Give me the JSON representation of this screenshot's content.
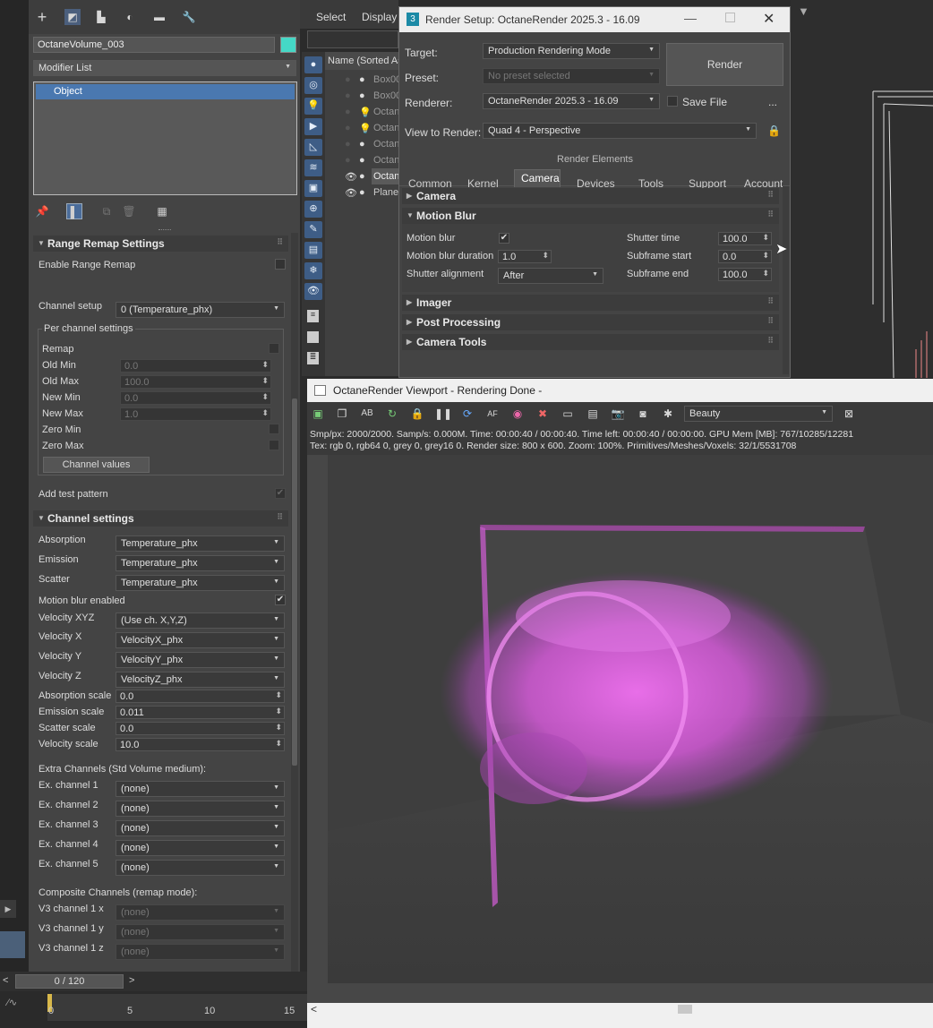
{
  "cmd_panel": {
    "object_name": "OctaneVolume_003",
    "object_color": "#45d8c6",
    "modifier_list": "Modifier List",
    "stack_item": "Object",
    "top_icons": [
      "create-icon",
      "modify-icon",
      "hierarchy-icon",
      "motion-icon",
      "display-icon",
      "utilities-icon"
    ]
  },
  "range_remap": {
    "title": "Range Remap Settings",
    "enable_label": "Enable Range Remap",
    "channel_setup_label": "Channel setup",
    "channel_setup_value": "0 (Temperature_phx)",
    "group_title": "Per channel settings",
    "remap_label": "Remap",
    "old_min_label": "Old Min",
    "old_min_value": "0.0",
    "old_max_label": "Old Max",
    "old_max_value": "100.0",
    "new_min_label": "New Min",
    "new_min_value": "0.0",
    "new_max_label": "New Max",
    "new_max_value": "1.0",
    "zero_min_label": "Zero Min",
    "zero_max_label": "Zero Max",
    "channel_values_btn": "Channel values",
    "test_pattern_label": "Add test pattern"
  },
  "channel_settings": {
    "title": "Channel settings",
    "absorption_label": "Absorption",
    "absorption_value": "Temperature_phx",
    "emission_label": "Emission",
    "emission_value": "Temperature_phx",
    "scatter_label": "Scatter",
    "scatter_value": "Temperature_phx",
    "motion_blur_label": "Motion blur enabled",
    "motion_blur_check": "✔",
    "vel_xyz_label": "Velocity XYZ",
    "vel_xyz_value": "(Use ch. X,Y,Z)",
    "vel_x_label": "Velocity X",
    "vel_x_value": "VelocityX_phx",
    "vel_y_label": "Velocity Y",
    "vel_y_value": "VelocityY_phx",
    "vel_z_label": "Velocity Z",
    "vel_z_value": "VelocityZ_phx",
    "abs_scale_label": "Absorption scale",
    "abs_scale_value": "0.0",
    "em_scale_label": "Emission scale",
    "em_scale_value": "0.011",
    "sc_scale_label": "Scatter scale",
    "sc_scale_value": "0.0",
    "vel_scale_label": "Velocity scale",
    "vel_scale_value": "10.0",
    "extra_title": "Extra Channels (Std Volume medium):",
    "extra": [
      {
        "label": "Ex. channel 1",
        "value": "(none)"
      },
      {
        "label": "Ex. channel 2",
        "value": "(none)"
      },
      {
        "label": "Ex. channel 3",
        "value": "(none)"
      },
      {
        "label": "Ex. channel 4",
        "value": "(none)"
      },
      {
        "label": "Ex. channel 5",
        "value": "(none)"
      }
    ],
    "composite_title": "Composite Channels (remap mode):",
    "v3": [
      {
        "label": "V3 channel 1 x",
        "value": "(none)"
      },
      {
        "label": "V3 channel 1 y",
        "value": "(none)"
      },
      {
        "label": "V3 channel 1 z",
        "value": "(none)"
      }
    ]
  },
  "timeline": {
    "frame": "0 / 120",
    "prev": "<",
    "next": ">",
    "ticks": [
      "0",
      "5",
      "10",
      "15"
    ]
  },
  "scene_explorer": {
    "menu_select": "Select",
    "menu_display": "Display",
    "header": "Name (Sorted As",
    "rows": [
      "Box00",
      "Box00",
      "Octan",
      "Octan",
      "Octan",
      "Octan",
      "Octan",
      "Plane"
    ]
  },
  "render_setup": {
    "title": "Render Setup: OctaneRender 2025.3 - 16.09",
    "target_label": "Target:",
    "target_value": "Production Rendering Mode",
    "preset_label": "Preset:",
    "preset_value": "No preset selected",
    "renderer_label": "Renderer:",
    "renderer_value": "OctaneRender 2025.3 - 16.09",
    "save_file": "Save File",
    "more": "...",
    "render_btn": "Render",
    "view_label": "View to Render:",
    "view_value": "Quad 4 - Perspective",
    "render_elements": "Render Elements",
    "tabs": [
      "Common",
      "Kernel",
      "Camera",
      "Devices",
      "Tools",
      "Support",
      "Account"
    ],
    "camera_rollout": "Camera",
    "motion_blur_rollout": "Motion Blur",
    "mb_label": "Motion blur",
    "mb_check": "✔",
    "mb_duration_label": "Motion blur duration",
    "mb_duration_value": "1.0",
    "shutter_align_label": "Shutter alignment",
    "shutter_align_value": "After",
    "shutter_time_label": "Shutter time",
    "shutter_time_value": "100.0",
    "subframe_start_label": "Subframe start",
    "subframe_start_value": "0.0",
    "subframe_end_label": "Subframe end",
    "subframe_end_value": "100.0",
    "imager_rollout": "Imager",
    "post_rollout": "Post Processing",
    "camtools_rollout": "Camera Tools"
  },
  "viewport": {
    "title": "OctaneRender Viewport - Rendering Done -",
    "pass_value": "Beauty",
    "stats_line1": "Smp/px: 2000/2000.   Samp/s: 0.000M.   Time: 00:00:40 / 00:00:40.   Time left: 00:00:40 / 00:00:00.   GPU Mem [MB]: 767/10285/12281",
    "stats_line2": "Tex: rgb 0, rgb64 0, grey 0, grey16 0.   Render size: 800 x 600.   Zoom: 100%.   Primitives/Meshes/Voxels: 32/1/5531708",
    "scroll_left": "<"
  },
  "colors": {
    "accent": "#3e5d86",
    "volume": "#d45ad8"
  }
}
